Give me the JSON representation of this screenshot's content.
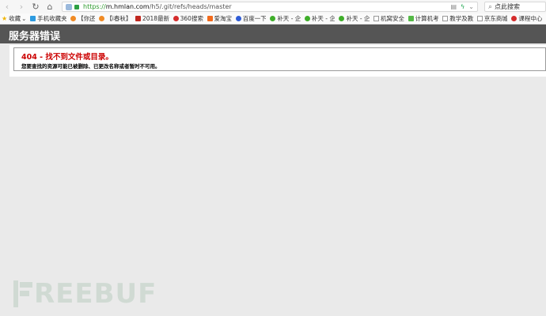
{
  "browser": {
    "url": {
      "scheme": "https://",
      "host": "m.hmlan.com",
      "path": "/h5/.git/refs/heads/master"
    },
    "search_placeholder": "点此搜索",
    "bookmarks_label": "收藏",
    "bookmarks": [
      {
        "label": "手机收藏夹",
        "color": "#2e9be0",
        "shape": "sq"
      },
      {
        "label": "【你还",
        "color": "#f08a24",
        "shape": "round"
      },
      {
        "label": "【i春秋】",
        "color": "#f08a24",
        "shape": "round"
      },
      {
        "label": "2018最新",
        "color": "#c0271f",
        "shape": "sq"
      },
      {
        "label": "360搜索",
        "color": "#d52c2c",
        "shape": "round"
      },
      {
        "label": "爱淘宝",
        "color": "#f26a1b",
        "shape": "sq"
      },
      {
        "label": "百度一下",
        "color": "#2f5cd6",
        "shape": "round"
      },
      {
        "label": "补天 - 企",
        "color": "#3fae2a",
        "shape": "round"
      },
      {
        "label": "补天 - 企",
        "color": "#3fae2a",
        "shape": "round"
      },
      {
        "label": "补天 - 企",
        "color": "#3fae2a",
        "shape": "round"
      },
      {
        "label": "机窝安全",
        "color": "#ffffff",
        "shape": "doc"
      },
      {
        "label": "计算机考",
        "color": "#55b947",
        "shape": "sq"
      },
      {
        "label": "教学及教",
        "color": "#ffffff",
        "shape": "doc"
      },
      {
        "label": "京东商城",
        "color": "#ffffff",
        "shape": "doc"
      },
      {
        "label": "课程中心",
        "color": "#d52c2c",
        "shape": "round"
      }
    ]
  },
  "page": {
    "header": "服务器错误",
    "error_title": "404 - 找不到文件或目录。",
    "error_message": "您要查找的资源可能已被删除、已更改名称或者暂时不可用。"
  },
  "watermark": {
    "text": "REEBUF"
  }
}
